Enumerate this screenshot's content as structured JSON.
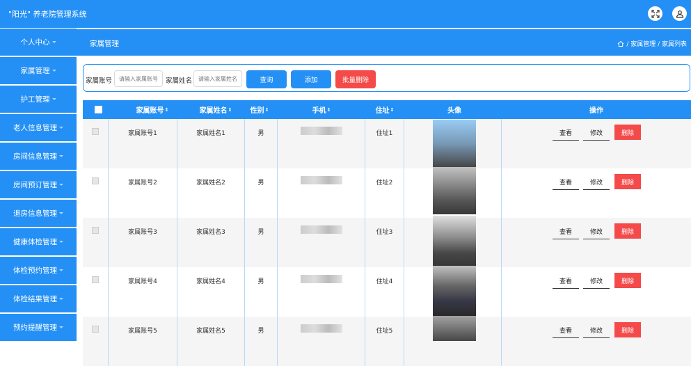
{
  "app": {
    "title": "\"阳光\" 养老院管理系统"
  },
  "sidebar": {
    "items": [
      {
        "label": "个人中心"
      },
      {
        "label": "家属管理"
      },
      {
        "label": "护工管理"
      },
      {
        "label": "老人信息管理"
      },
      {
        "label": "房间信息管理"
      },
      {
        "label": "房间预订管理"
      },
      {
        "label": "退房信息管理"
      },
      {
        "label": "健康体检管理"
      },
      {
        "label": "体检预约管理"
      },
      {
        "label": "体检结果管理"
      },
      {
        "label": "预约提醒管理"
      }
    ]
  },
  "header": {
    "title": "家属管理",
    "breadcrumb": "/ 家属管理 / 家属列表"
  },
  "search": {
    "account_label": "家属账号",
    "account_placeholder": "请输入家属账号",
    "name_label": "家属姓名",
    "name_placeholder": "请输入家属姓名",
    "query_btn": "查询",
    "add_btn": "添加",
    "batch_delete_btn": "批量删除"
  },
  "table": {
    "headers": {
      "account": "家属账号",
      "name": "家属姓名",
      "gender": "性别",
      "phone": "手机",
      "address": "住址",
      "avatar": "头像",
      "actions": "操作"
    },
    "sort_glyph": "⇕",
    "actions": {
      "view": "查看",
      "edit": "修改",
      "delete": "删除"
    },
    "rows": [
      {
        "account": "家属账号1",
        "name": "家属姓名1",
        "gender": "男",
        "address": "住址1"
      },
      {
        "account": "家属账号2",
        "name": "家属姓名2",
        "gender": "男",
        "address": "住址2"
      },
      {
        "account": "家属账号3",
        "name": "家属姓名3",
        "gender": "男",
        "address": "住址3"
      },
      {
        "account": "家属账号4",
        "name": "家属姓名4",
        "gender": "男",
        "address": "住址4"
      },
      {
        "account": "家属账号5",
        "name": "家属姓名5",
        "gender": "男",
        "address": "住址5"
      }
    ]
  },
  "colors": {
    "primary": "#2490f5",
    "danger": "#f44a4a"
  }
}
